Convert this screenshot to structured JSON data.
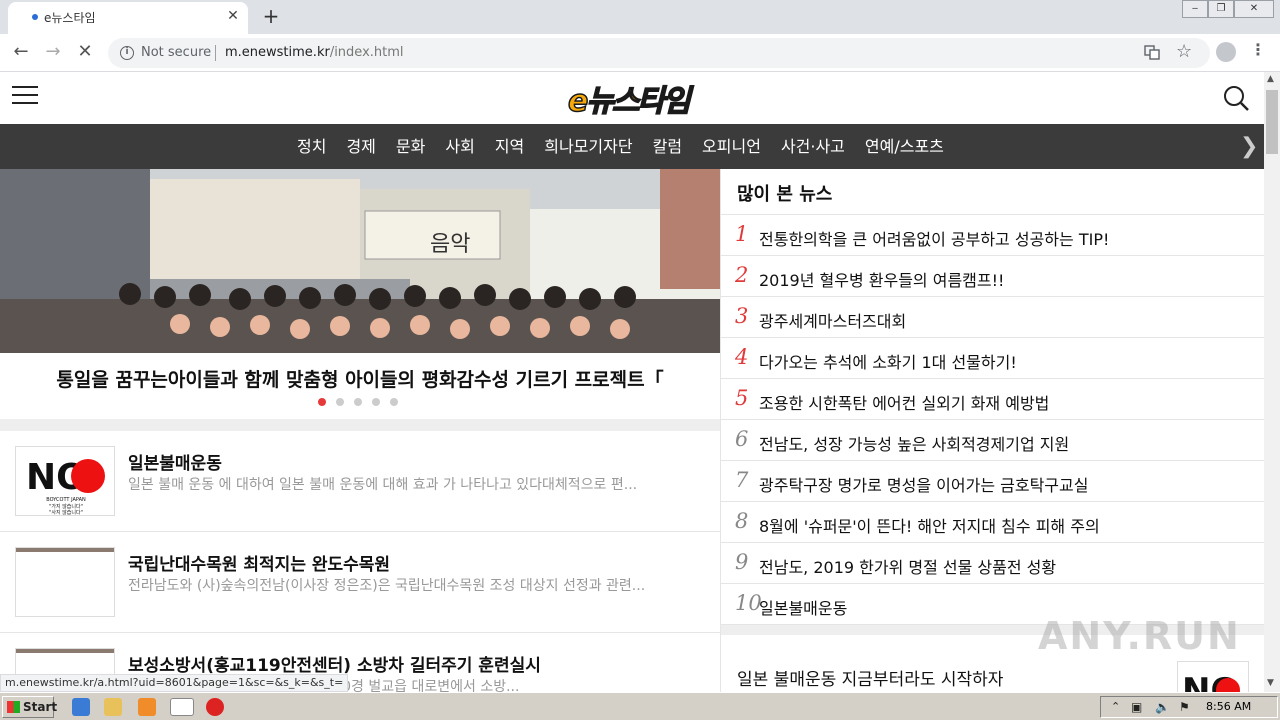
{
  "browser": {
    "tab_title": "e뉴스타임",
    "security_label": "Not secure",
    "url_host": "m.enewstime.kr",
    "url_path": "/index.html",
    "status_url": "m.enewstime.kr/a.html?uid=8601&page=1&sc=&s_k=&s_t="
  },
  "site": {
    "logo_text": "e뉴스타임",
    "categories": [
      "정치",
      "경제",
      "문화",
      "사회",
      "지역",
      "희나모기자단",
      "칼럼",
      "오피니언",
      "사건·사고",
      "연예/스포츠"
    ]
  },
  "hero": {
    "caption": "통일을 꿈꾸는아이들과 함께 맞춤형 아이들의 평화감수성 기르기 프로젝트「",
    "sign_text": "음악",
    "slides_total": 5,
    "slide_active": 1
  },
  "news": [
    {
      "title": "일본불매운동",
      "summary": "일본 불매 운동 에 대하여 일본 불매 운동에 대해 효과 가 나타나고 있다대체적으로 편...",
      "thumb_label": "NO",
      "thumb_sub1": "BOYCOTT JAPAN",
      "thumb_sub2": "\"가지 않습니다\"",
      "thumb_sub3": "\"사지 않습니다\""
    },
    {
      "title": "국립난대수목원 최적지는 완도수목원",
      "summary": "전라남도와 (사)숲속의전남(이사장 정은조)은 국립난대수목원 조성 대상지 선정과 관련..."
    },
    {
      "title": "보성소방서(홍교119안전센터) 소방차 길터주기 훈련실시",
      "summary": "홍교119안전센터는 7월 18일 14:00경 벌교읍 대로변에서 소방..."
    }
  ],
  "popular": {
    "heading": "많이 본 뉴스",
    "items": [
      {
        "rank": "1",
        "title": "전통한의학을 큰 어려움없이 공부하고 성공하는 TIP!"
      },
      {
        "rank": "2",
        "title": "2019년 혈우병 환우들의 여름캠프!!"
      },
      {
        "rank": "3",
        "title": "광주세계마스터즈대회"
      },
      {
        "rank": "4",
        "title": "다가오는 추석에 소화기 1대 선물하기!"
      },
      {
        "rank": "5",
        "title": "조용한 시한폭탄 에어컨 실외기 화재 예방법"
      },
      {
        "rank": "6",
        "title": "전남도, 성장 가능성 높은 사회적경제기업 지원"
      },
      {
        "rank": "7",
        "title": "광주탁구장 명가로 명성을 이어가는 금호탁구교실"
      },
      {
        "rank": "8",
        "title": "8월에 '슈퍼문'이 뜬다! 해안 저지대 침수 피해 주의"
      },
      {
        "rank": "9",
        "title": "전남도, 2019 한가위 명절 선물 상품전 성황"
      },
      {
        "rank": "10",
        "title": "일본불매운동"
      }
    ],
    "extra_title": "일본 불매운동 지금부터라도 시작하자",
    "extra_thumb_label": "NO"
  },
  "taskbar": {
    "start_label": "Start",
    "clock": "8:56 AM"
  },
  "watermark": "ANY.RUN",
  "colors": {
    "accent_red": "#e03a3a",
    "nav_bg": "#3b3b3b",
    "logo_orange": "#f7a90a"
  }
}
